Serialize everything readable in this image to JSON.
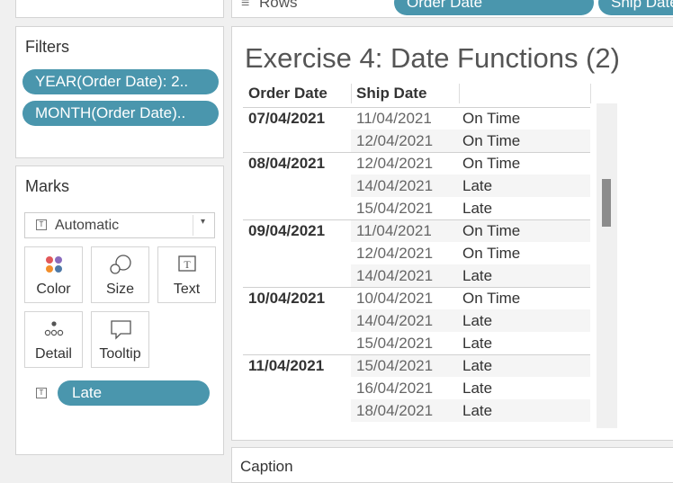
{
  "shelf": {
    "rows_label": "Rows",
    "pills": [
      "Order Date",
      "Ship Date"
    ]
  },
  "filters": {
    "title": "Filters",
    "pills": [
      "YEAR(Order Date): 2..",
      "MONTH(Order Date).."
    ]
  },
  "marks": {
    "title": "Marks",
    "type_select": "Automatic",
    "buttons": {
      "color": "Color",
      "size": "Size",
      "text": "Text",
      "detail": "Detail",
      "tooltip": "Tooltip"
    },
    "text_pill": "Late"
  },
  "view": {
    "title": "Exercise 4: Date Functions (2)",
    "headers": {
      "order_date": "Order Date",
      "ship_date": "Ship Date"
    },
    "rows": [
      {
        "order": "07/04/2021",
        "ship": "11/04/2021",
        "status": "On Time"
      },
      {
        "order": "",
        "ship": "12/04/2021",
        "status": "On Time"
      },
      {
        "order": "08/04/2021",
        "ship": "12/04/2021",
        "status": "On Time"
      },
      {
        "order": "",
        "ship": "14/04/2021",
        "status": "Late"
      },
      {
        "order": "",
        "ship": "15/04/2021",
        "status": "Late"
      },
      {
        "order": "09/04/2021",
        "ship": "11/04/2021",
        "status": "On Time"
      },
      {
        "order": "",
        "ship": "12/04/2021",
        "status": "On Time"
      },
      {
        "order": "",
        "ship": "14/04/2021",
        "status": "Late"
      },
      {
        "order": "10/04/2021",
        "ship": "10/04/2021",
        "status": "On Time"
      },
      {
        "order": "",
        "ship": "14/04/2021",
        "status": "Late"
      },
      {
        "order": "",
        "ship": "15/04/2021",
        "status": "Late"
      },
      {
        "order": "11/04/2021",
        "ship": "15/04/2021",
        "status": "Late"
      },
      {
        "order": "",
        "ship": "16/04/2021",
        "status": "Late"
      },
      {
        "order": "",
        "ship": "18/04/2021",
        "status": "Late"
      }
    ]
  },
  "caption": {
    "title": "Caption"
  }
}
